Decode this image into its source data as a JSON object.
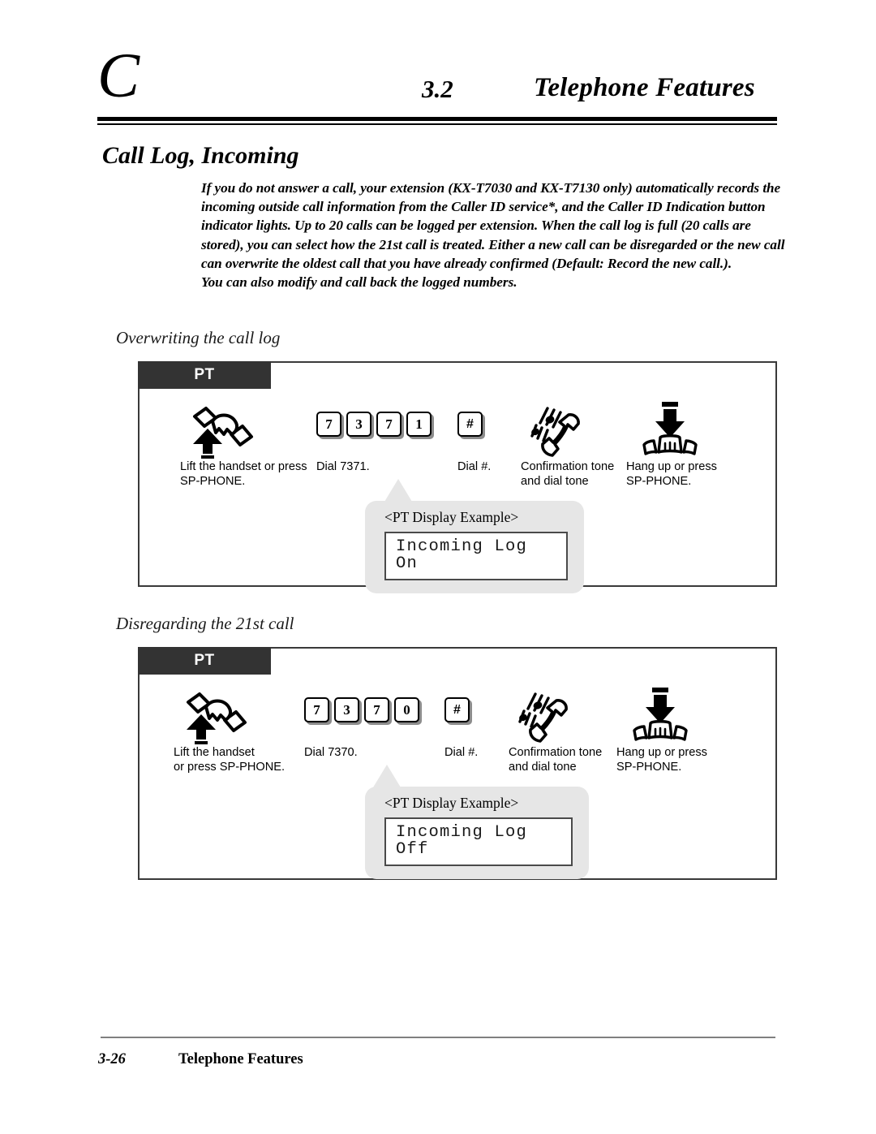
{
  "header": {
    "chapter_letter": "C",
    "section_number": "3.2",
    "section_title": "Telephone Features"
  },
  "feature": {
    "title": "Call Log, Incoming",
    "intro_paragraph": "If you do not answer a call, your extension (KX-T7030 and KX-T7130 only) automatically records the incoming outside call information from the Caller ID service*, and the Caller ID Indication button indicator lights. Up to 20 calls can be logged per extension. When the call log is full (20 calls are stored), you can select how the 21st call is treated. Either a new call can be disregarded or the new call can overwrite the oldest call that you have already confirmed (Default: Record the new call.).",
    "intro_paragraph_2": "You can also modify and call back the logged numbers."
  },
  "procedures": [
    {
      "heading": "Overwriting the call log",
      "tab_label": "PT",
      "steps": [
        {
          "icon": "lift-handset-icon",
          "caption": "Lift the handset or press\nSP-PHONE."
        },
        {
          "icon": "keypad-keys",
          "keys": [
            "7",
            "3",
            "7",
            "1"
          ],
          "caption": "Dial 7371."
        },
        {
          "icon": "keypad-keys",
          "keys": [
            "#"
          ],
          "caption": "Dial #."
        },
        {
          "icon": "confirmation-tone-icon",
          "caption": "Confirmation tone\nand dial tone"
        },
        {
          "icon": "hang-up-icon",
          "caption": "Hang up or press\nSP-PHONE."
        }
      ],
      "callout": {
        "label": "<PT Display Example>",
        "display_text": "Incoming Log On"
      }
    },
    {
      "heading": "Disregarding the 21st call",
      "tab_label": "PT",
      "steps": [
        {
          "icon": "lift-handset-icon",
          "caption": "Lift the handset\nor press SP-PHONE."
        },
        {
          "icon": "keypad-keys",
          "keys": [
            "7",
            "3",
            "7",
            "0"
          ],
          "caption": "Dial 7370."
        },
        {
          "icon": "keypad-keys",
          "keys": [
            "#"
          ],
          "caption": "Dial #."
        },
        {
          "icon": "confirmation-tone-icon",
          "caption": "Confirmation tone\nand dial tone"
        },
        {
          "icon": "hang-up-icon",
          "caption": "Hang up or press\nSP-PHONE."
        }
      ],
      "callout": {
        "label": "<PT Display Example>",
        "display_text": "Incoming Log Off"
      }
    }
  ],
  "footer": {
    "page_number": "3-26",
    "title": "Telephone Features"
  },
  "colors": {
    "tab_background": "#333333",
    "callout_background": "#e6e6e6",
    "box_border": "#3a3a3a",
    "footer_rule": "#808080"
  }
}
